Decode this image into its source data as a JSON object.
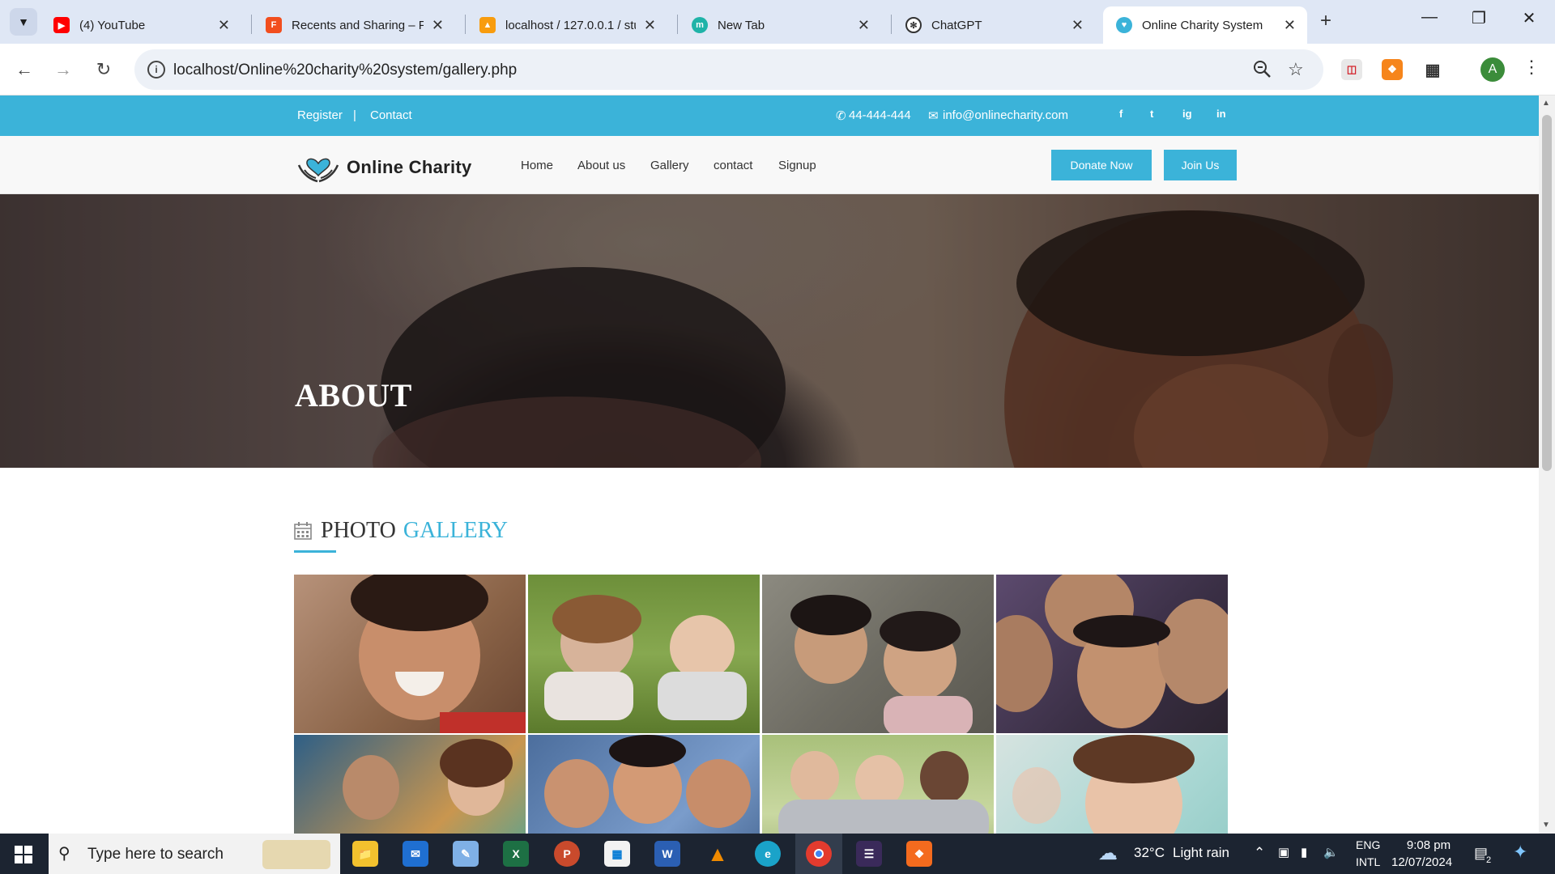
{
  "browser": {
    "tabs": [
      {
        "title": "(4) YouTube",
        "icon": "youtube-icon",
        "color": "#ff0000"
      },
      {
        "title": "Recents and Sharing – Fi",
        "icon": "figma-icon",
        "color": "#f24e1e"
      },
      {
        "title": "localhost / 127.0.0.1 / stu",
        "icon": "phpmyadmin-icon",
        "color": "#f89c0e"
      },
      {
        "title": "New Tab",
        "icon": "m-icon",
        "color": "#1fb3a8"
      },
      {
        "title": "ChatGPT",
        "icon": "chatgpt-icon",
        "color": "#333333"
      },
      {
        "title": "Online Charity System",
        "icon": "charity-icon",
        "color": "#3bb3d9"
      }
    ],
    "url": "localhost/Online%20charity%20system/gallery.php",
    "avatar_letter": "A"
  },
  "site": {
    "topbar": {
      "register": "Register",
      "separator": "|",
      "contact": "Contact",
      "phone": "44-444-444",
      "email": "info@onlinecharity.com",
      "social": [
        "f",
        "t",
        "ig",
        "in"
      ]
    },
    "logo": "Online Charity",
    "menu": [
      "Home",
      "About us",
      "Gallery",
      "contact",
      "Signup"
    ],
    "buttons": {
      "donate": "Donate Now",
      "join": "Join Us"
    },
    "hero_title": "ABOUT",
    "gallery_title_1": "PHOTO",
    "gallery_title_2": "GALLERY",
    "accent_color": "#3bb3d9"
  },
  "taskbar": {
    "search_placeholder": "Type here to search",
    "weather_temp": "32°C",
    "weather_text": "Light rain",
    "lang_1": "ENG",
    "lang_2": "INTL",
    "time": "9:08 pm",
    "date": "12/07/2024",
    "notif_count": "2"
  }
}
